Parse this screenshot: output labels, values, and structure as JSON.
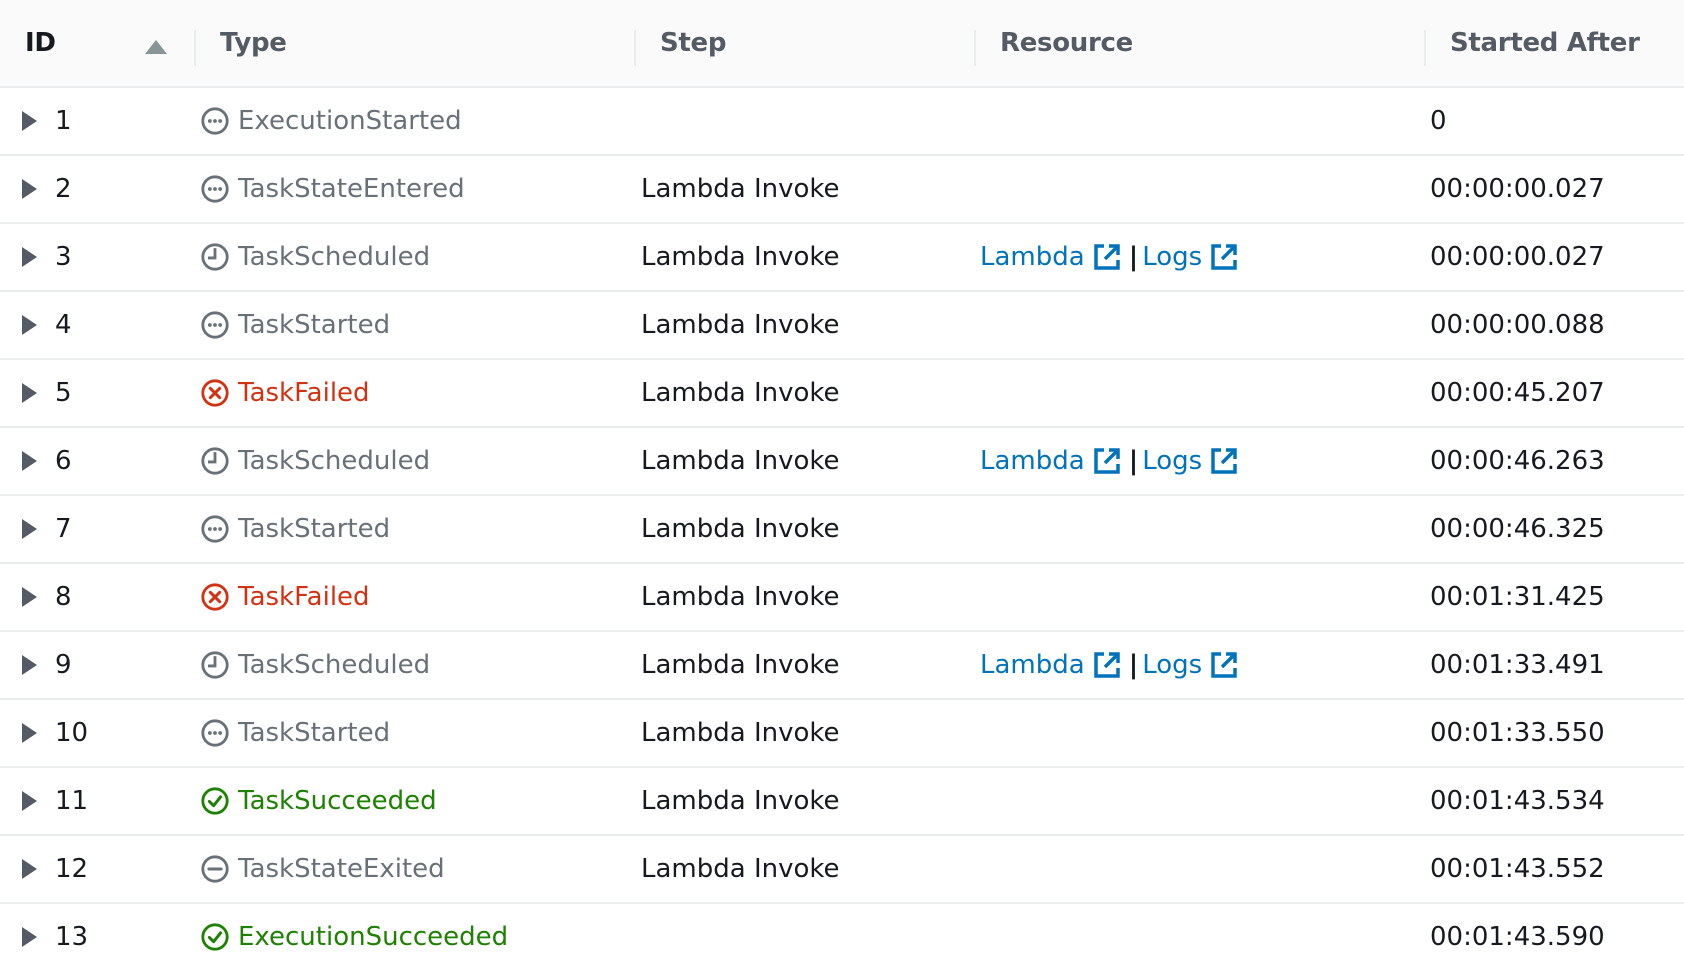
{
  "table": {
    "columns": [
      {
        "key": "id",
        "label": "ID",
        "sorted": "ascending"
      },
      {
        "key": "type",
        "label": "Type"
      },
      {
        "key": "step",
        "label": "Step"
      },
      {
        "key": "resource",
        "label": "Resource"
      },
      {
        "key": "started_after",
        "label": "Started After"
      }
    ],
    "rows": [
      {
        "id": "1",
        "type": "ExecutionStarted",
        "type_icon": "dots-circle-icon",
        "status": "neutral",
        "step": "",
        "resource": null,
        "started_after": "0"
      },
      {
        "id": "2",
        "type": "TaskStateEntered",
        "type_icon": "dots-circle-icon",
        "status": "neutral",
        "step": "Lambda Invoke",
        "resource": null,
        "started_after": "00:00:00.027"
      },
      {
        "id": "3",
        "type": "TaskScheduled",
        "type_icon": "clock-icon",
        "status": "neutral",
        "step": "Lambda Invoke",
        "resource": {
          "links": [
            "Lambda",
            "Logs"
          ],
          "separator": "|"
        },
        "started_after": "00:00:00.027"
      },
      {
        "id": "4",
        "type": "TaskStarted",
        "type_icon": "dots-circle-icon",
        "status": "neutral",
        "step": "Lambda Invoke",
        "resource": null,
        "started_after": "00:00:00.088"
      },
      {
        "id": "5",
        "type": "TaskFailed",
        "type_icon": "x-circle-icon",
        "status": "error",
        "step": "Lambda Invoke",
        "resource": null,
        "started_after": "00:00:45.207"
      },
      {
        "id": "6",
        "type": "TaskScheduled",
        "type_icon": "clock-icon",
        "status": "neutral",
        "step": "Lambda Invoke",
        "resource": {
          "links": [
            "Lambda",
            "Logs"
          ],
          "separator": "|"
        },
        "started_after": "00:00:46.263"
      },
      {
        "id": "7",
        "type": "TaskStarted",
        "type_icon": "dots-circle-icon",
        "status": "neutral",
        "step": "Lambda Invoke",
        "resource": null,
        "started_after": "00:00:46.325"
      },
      {
        "id": "8",
        "type": "TaskFailed",
        "type_icon": "x-circle-icon",
        "status": "error",
        "step": "Lambda Invoke",
        "resource": null,
        "started_after": "00:01:31.425"
      },
      {
        "id": "9",
        "type": "TaskScheduled",
        "type_icon": "clock-icon",
        "status": "neutral",
        "step": "Lambda Invoke",
        "resource": {
          "links": [
            "Lambda",
            "Logs"
          ],
          "separator": "|"
        },
        "started_after": "00:01:33.491"
      },
      {
        "id": "10",
        "type": "TaskStarted",
        "type_icon": "dots-circle-icon",
        "status": "neutral",
        "step": "Lambda Invoke",
        "resource": null,
        "started_after": "00:01:33.550"
      },
      {
        "id": "11",
        "type": "TaskSucceeded",
        "type_icon": "check-circle-icon",
        "status": "success",
        "step": "Lambda Invoke",
        "resource": null,
        "started_after": "00:01:43.534"
      },
      {
        "id": "12",
        "type": "TaskStateExited",
        "type_icon": "minus-circle-icon",
        "status": "neutral",
        "step": "Lambda Invoke",
        "resource": null,
        "started_after": "00:01:43.552"
      },
      {
        "id": "13",
        "type": "ExecutionSucceeded",
        "type_icon": "check-circle-icon",
        "status": "success",
        "step": "",
        "resource": null,
        "started_after": "00:01:43.590"
      }
    ]
  },
  "colors": {
    "neutral": "#687078",
    "error": "#d13212",
    "success": "#1d8102",
    "link": "#0073bb"
  }
}
